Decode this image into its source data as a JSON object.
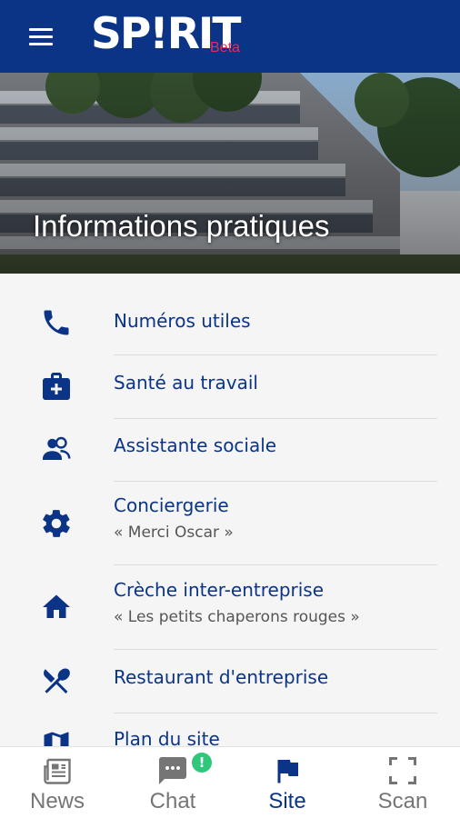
{
  "header": {
    "logo": "SP!RIT",
    "beta": "Beta",
    "menu_icon": "hamburger-menu-icon",
    "background_color": "#0b3487",
    "accent_color": "#e2314c"
  },
  "hero": {
    "title": "Informations pratiques"
  },
  "items": [
    {
      "title": "Numéros utiles",
      "subtitle": "",
      "icon": "phone-icon"
    },
    {
      "title": "Santé au travail",
      "subtitle": "",
      "icon": "medical-kit-icon"
    },
    {
      "title": "Assistante sociale",
      "subtitle": "",
      "icon": "people-icon"
    },
    {
      "title": "Conciergerie",
      "subtitle": "« Merci Oscar »",
      "icon": "gear-icon"
    },
    {
      "title": "Crèche inter-entreprise",
      "subtitle": "« Les petits chaperons rouges »",
      "icon": "home-icon"
    },
    {
      "title": "Restaurant d'entreprise",
      "subtitle": "",
      "icon": "fork-knife-icon"
    },
    {
      "title": "Plan du site",
      "subtitle": "",
      "icon": "map-icon"
    }
  ],
  "nav": {
    "tabs": [
      {
        "label": "News",
        "icon": "newspaper-icon",
        "active": false
      },
      {
        "label": "Chat",
        "icon": "chat-icon",
        "active": false
      },
      {
        "label": "Site",
        "icon": "flag-icon",
        "active": true
      },
      {
        "label": "Scan",
        "icon": "scan-frame-icon",
        "active": false
      }
    ],
    "chat_badge": "!",
    "active_color": "#0b3487",
    "inactive_color": "#757575",
    "badge_color": "#2fc77a"
  }
}
